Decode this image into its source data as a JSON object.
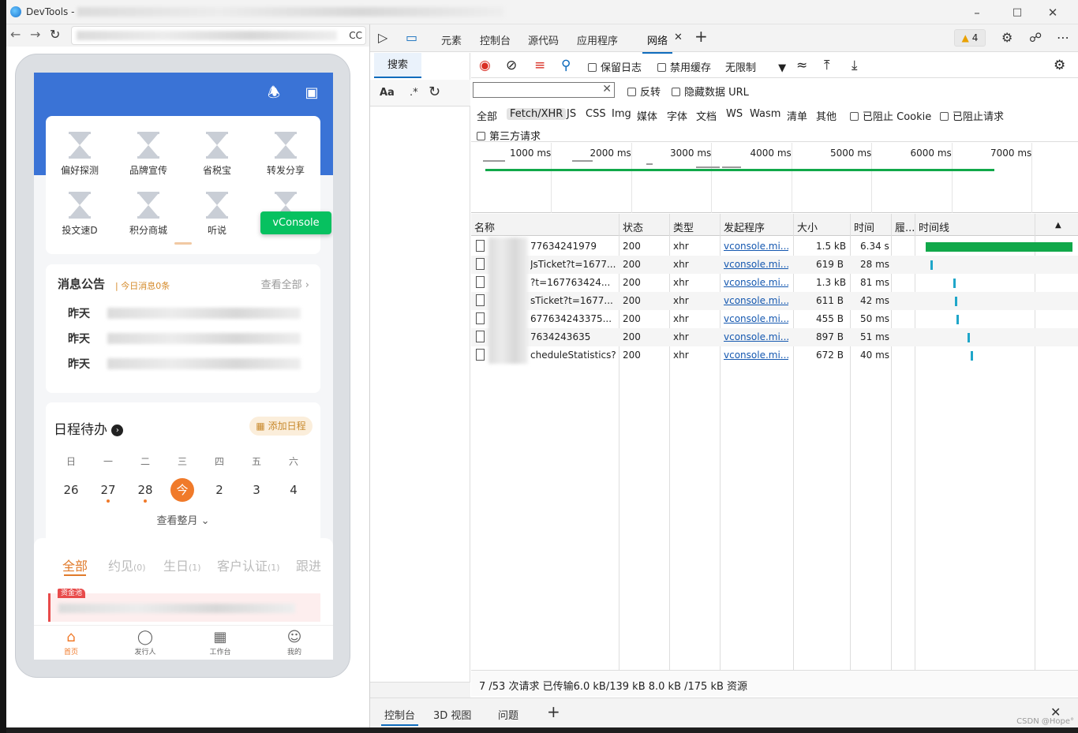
{
  "window": {
    "title": "DevTools -",
    "controls": [
      "minimize",
      "maximize",
      "close"
    ]
  },
  "browser": {
    "address_suffix": "CC"
  },
  "phone": {
    "grid_items": [
      "偏好探测",
      "品牌宣传",
      "省税宝",
      "转发分享",
      "投文速D",
      "积分商城",
      "听说"
    ],
    "vconsole_label": "vConsole",
    "notice": {
      "title": "消息公告",
      "subtitle": "| 今日消息0条",
      "view_all": "查看全部",
      "rows": [
        "昨天",
        "昨天",
        "昨天"
      ]
    },
    "schedule": {
      "title": "日程待办",
      "add_label": "添加日程",
      "weekdays": [
        "日",
        "一",
        "二",
        "三",
        "四",
        "五",
        "六"
      ],
      "days": [
        "26",
        "27",
        "28",
        "今",
        "2",
        "3",
        "4"
      ],
      "month_link": "查看整月"
    },
    "tabs": [
      {
        "label": "全部",
        "count": ""
      },
      {
        "label": "约见",
        "count": "(0)"
      },
      {
        "label": "生日",
        "count": "(1)"
      },
      {
        "label": "客户认证",
        "count": "(1)"
      },
      {
        "label": "跟进",
        "count": ""
      }
    ],
    "list_badge": "资金池",
    "bottom_nav": [
      "首页",
      "发行人",
      "工作台",
      "我的"
    ]
  },
  "devtools": {
    "tabs": [
      "元素",
      "控制台",
      "源代码",
      "应用程序",
      "网络"
    ],
    "warning_count": "4",
    "search_tab": "搜索",
    "search_opts": [
      "Aa",
      ".*"
    ],
    "toolbar": {
      "preserve_log": "保留日志",
      "disable_cache": "禁用缓存",
      "throttle": "无限制"
    },
    "filter": {
      "invert": "反转",
      "hide_data_urls": "隐藏数据 URL",
      "types": [
        "全部",
        "Fetch/XHR",
        "JS",
        "CSS",
        "Img",
        "媒体",
        "字体",
        "文档",
        "WS",
        "Wasm",
        "清单",
        "其他"
      ],
      "blocked_cookies": "已阻止 Cookie",
      "blocked_requests": "已阻止请求",
      "third_party": "第三方请求"
    },
    "overview_ticks": [
      "1000 ms",
      "2000 ms",
      "3000 ms",
      "4000 ms",
      "5000 ms",
      "6000 ms",
      "7000 ms"
    ],
    "columns": [
      "名称",
      "状态",
      "类型",
      "发起程序",
      "大小",
      "时间",
      "履...",
      "时间线"
    ],
    "requests": [
      {
        "name": "77634241979",
        "status": "200",
        "type": "xhr",
        "initiator": "vconsole.mi...",
        "size": "1.5 kB",
        "time": "6.34 s",
        "wf_start": 0.05,
        "wf_len": 0.95,
        "wf_color": "#11a84a"
      },
      {
        "name": "JsTicket?t=1677...",
        "status": "200",
        "type": "xhr",
        "initiator": "vconsole.mi...",
        "size": "619 B",
        "time": "28 ms",
        "wf_start": 0.08,
        "wf_len": 0.012,
        "wf_color": "#1fa6c9"
      },
      {
        "name": "?t=167763424...",
        "status": "200",
        "type": "xhr",
        "initiator": "vconsole.mi...",
        "size": "1.3 kB",
        "time": "81 ms",
        "wf_start": 0.23,
        "wf_len": 0.015,
        "wf_color": "#1fa6c9"
      },
      {
        "name": "sTicket?t=1677...",
        "status": "200",
        "type": "xhr",
        "initiator": "vconsole.mi...",
        "size": "611 B",
        "time": "42 ms",
        "wf_start": 0.24,
        "wf_len": 0.012,
        "wf_color": "#1fa6c9"
      },
      {
        "name": "677634243375...",
        "status": "200",
        "type": "xhr",
        "initiator": "vconsole.mi...",
        "size": "455 B",
        "time": "50 ms",
        "wf_start": 0.25,
        "wf_len": 0.012,
        "wf_color": "#1fa6c9"
      },
      {
        "name": "7634243635",
        "status": "200",
        "type": "xhr",
        "initiator": "vconsole.mi...",
        "size": "897 B",
        "time": "51 ms",
        "wf_start": 0.32,
        "wf_len": 0.012,
        "wf_color": "#1fa6c9"
      },
      {
        "name": "cheduleStatistics?...",
        "status": "200",
        "type": "xhr",
        "initiator": "vconsole.mi...",
        "size": "672 B",
        "time": "40 ms",
        "wf_start": 0.34,
        "wf_len": 0.012,
        "wf_color": "#1fa6c9"
      }
    ],
    "status_summary": "7 /53 次请求  已传输6.0 kB/139 kB  8.0 kB /175 kB 资源",
    "drawer_tabs": [
      "控制台",
      "3D 视图",
      "问题"
    ]
  },
  "watermark": "CSDN @Hope°"
}
